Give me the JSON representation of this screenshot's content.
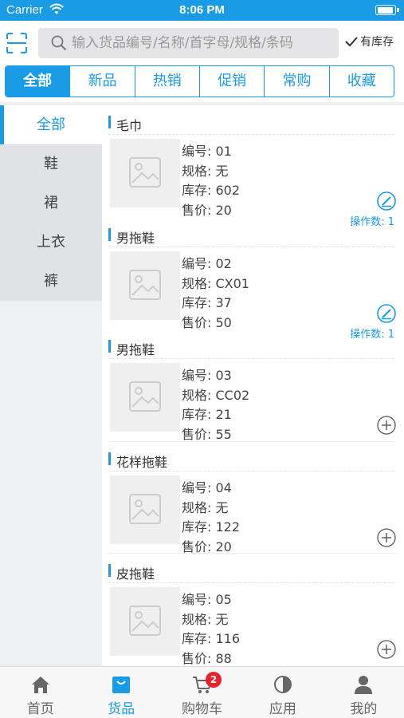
{
  "status_bar": {
    "carrier": "Carrier",
    "time": "8:06 PM"
  },
  "search": {
    "placeholder": "输入货品编号/名称/首字母/规格/条码",
    "stock_filter_label": "有库存"
  },
  "tabs": [
    {
      "label": "全部",
      "active": true
    },
    {
      "label": "新品",
      "active": false
    },
    {
      "label": "热销",
      "active": false
    },
    {
      "label": "促销",
      "active": false
    },
    {
      "label": "常购",
      "active": false
    },
    {
      "label": "收藏",
      "active": false
    }
  ],
  "sidebar": {
    "items": [
      {
        "label": "全部",
        "active": true
      },
      {
        "label": "鞋",
        "active": false
      },
      {
        "label": "裙",
        "active": false
      },
      {
        "label": "上衣",
        "active": false
      },
      {
        "label": "裤",
        "active": false
      }
    ]
  },
  "products": [
    {
      "name": "毛巾",
      "code_label": "编号: ",
      "code": "01",
      "spec_label": "规格: ",
      "spec": "无",
      "stock_label": "库存: ",
      "stock": "602",
      "price_label": "售价: ",
      "price": "20",
      "action": "edit-circle-icon",
      "op_count": "操作数: 1"
    },
    {
      "name": "男拖鞋",
      "code_label": "编号: ",
      "code": "02",
      "spec_label": "规格: ",
      "spec": "CX01",
      "stock_label": "库存: ",
      "stock": "37",
      "price_label": "售价: ",
      "price": "50",
      "action": "edit-circle-icon",
      "op_count": "操作数: 1"
    },
    {
      "name": "男拖鞋",
      "code_label": "编号: ",
      "code": "03",
      "spec_label": "规格: ",
      "spec": "CC02",
      "stock_label": "库存: ",
      "stock": "21",
      "price_label": "售价: ",
      "price": "55",
      "action": "add-circle-icon",
      "op_count": ""
    },
    {
      "name": "花样拖鞋",
      "code_label": "编号: ",
      "code": "04",
      "spec_label": "规格: ",
      "spec": "无",
      "stock_label": "库存: ",
      "stock": "122",
      "price_label": "售价: ",
      "price": "20",
      "action": "add-circle-icon",
      "op_count": ""
    },
    {
      "name": "皮拖鞋",
      "code_label": "编号: ",
      "code": "05",
      "spec_label": "规格: ",
      "spec": "无",
      "stock_label": "库存: ",
      "stock": "116",
      "price_label": "售价: ",
      "price": "88",
      "action": "add-circle-icon",
      "op_count": ""
    }
  ],
  "bottom_nav": [
    {
      "label": "首页",
      "icon": "home-icon",
      "active": false
    },
    {
      "label": "货品",
      "icon": "bag-icon",
      "active": true
    },
    {
      "label": "购物车",
      "icon": "cart-icon",
      "active": false
    },
    {
      "label": "应用",
      "icon": "apps-icon",
      "active": false
    },
    {
      "label": "我的",
      "icon": "profile-icon",
      "active": false
    }
  ],
  "cart_badge": "2",
  "colors": {
    "accent": "#1a9be6",
    "badge": "#e8222a"
  }
}
